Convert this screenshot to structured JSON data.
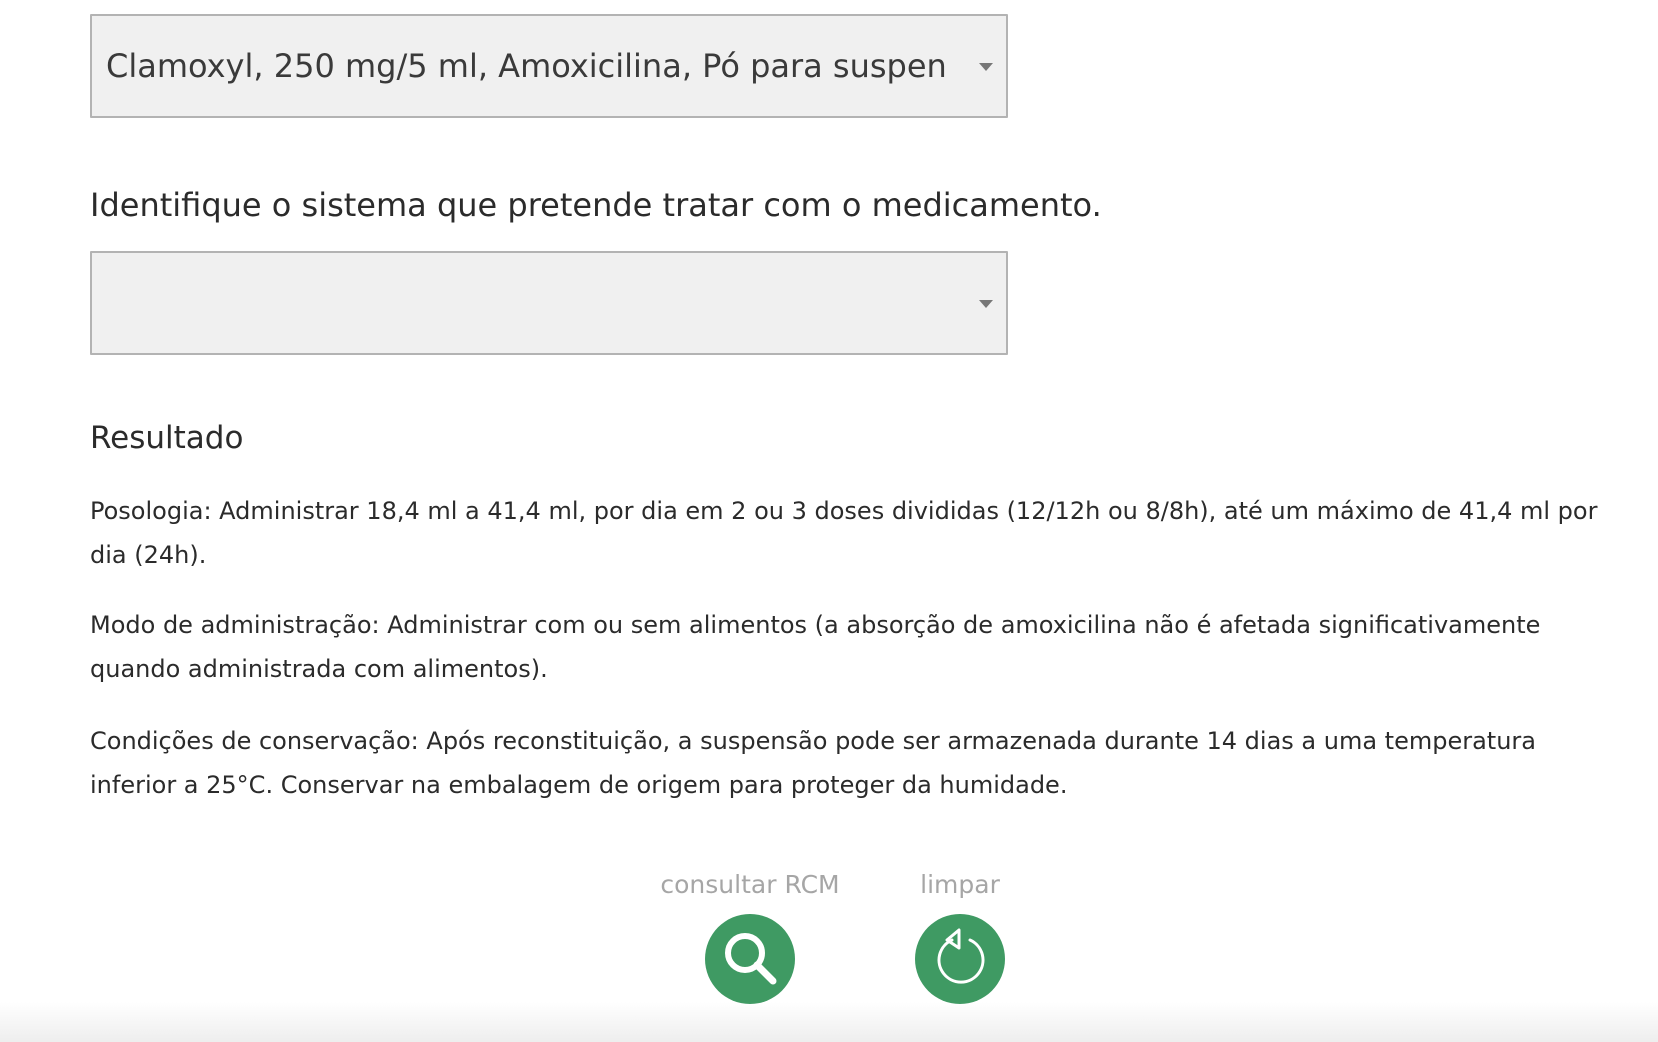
{
  "selects": {
    "medicamento": {
      "value": "Clamoxyl, 250 mg/5 ml, Amoxicilina, Pó para suspen..."
    },
    "sistema": {
      "value": ""
    }
  },
  "question": "Identifique o sistema que pretende tratar com o medicamento.",
  "result": {
    "title": "Resultado",
    "posologia": "Posologia: Administrar 18,4 ml a 41,4 ml, por dia em 2 ou 3 doses divididas (12/12h ou 8/8h), até um máximo de 41,4 ml por dia (24h).",
    "modo": "Modo de administração: Administrar com ou sem alimentos (a absorção de amoxicilina não é afetada significativamente quando administrada com alimentos).",
    "conservacao": "Condições de conservação: Após reconstituição, a suspensão pode ser armazenada durante 14 dias a uma temperatura inferior a 25°C. Conservar na embalagem de origem para proteger da humidade."
  },
  "actions": {
    "consultar_label": "consultar RCM",
    "limpar_label": "limpar"
  },
  "icons": {
    "consultar": "search-icon",
    "limpar": "reset-icon"
  },
  "colors": {
    "accent": "#3f9a63",
    "select_bg": "#f0f0f0",
    "label_gray": "#a6a6a6"
  }
}
